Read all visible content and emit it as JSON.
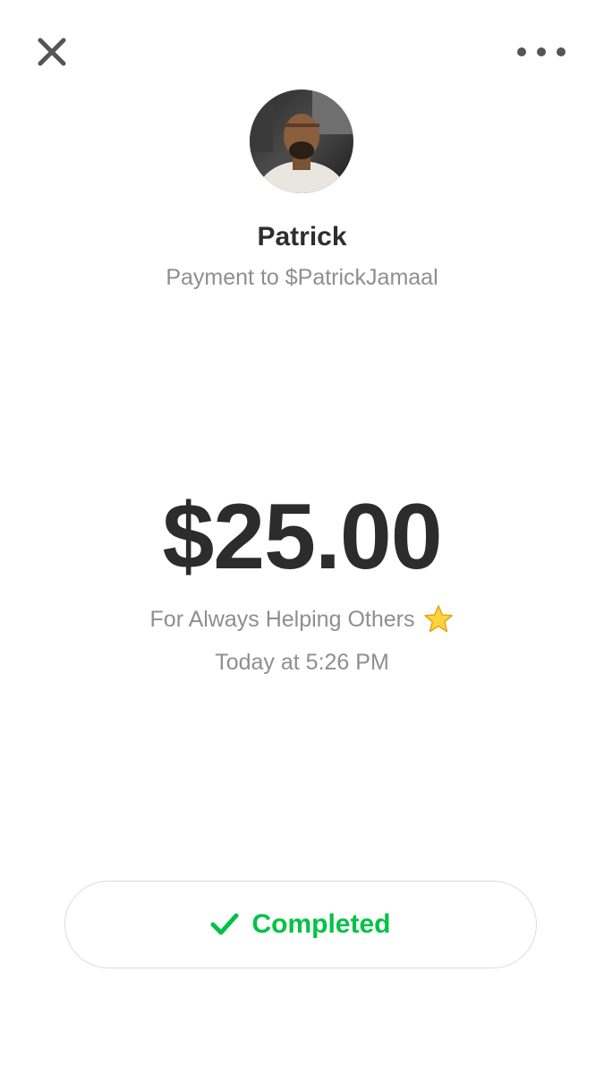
{
  "header": {
    "close_icon": "close-icon",
    "more_icon": "more-options-icon"
  },
  "recipient": {
    "name": "Patrick",
    "payment_line": "Payment to $PatrickJamaal",
    "avatar": "avatar-photo"
  },
  "payment": {
    "amount": "$25.00",
    "note": "For Always Helping Others",
    "note_emoji": "star-icon",
    "timestamp": "Today at 5:26 PM"
  },
  "status": {
    "label": "Completed",
    "icon": "checkmark-icon",
    "color": "#00c244"
  }
}
